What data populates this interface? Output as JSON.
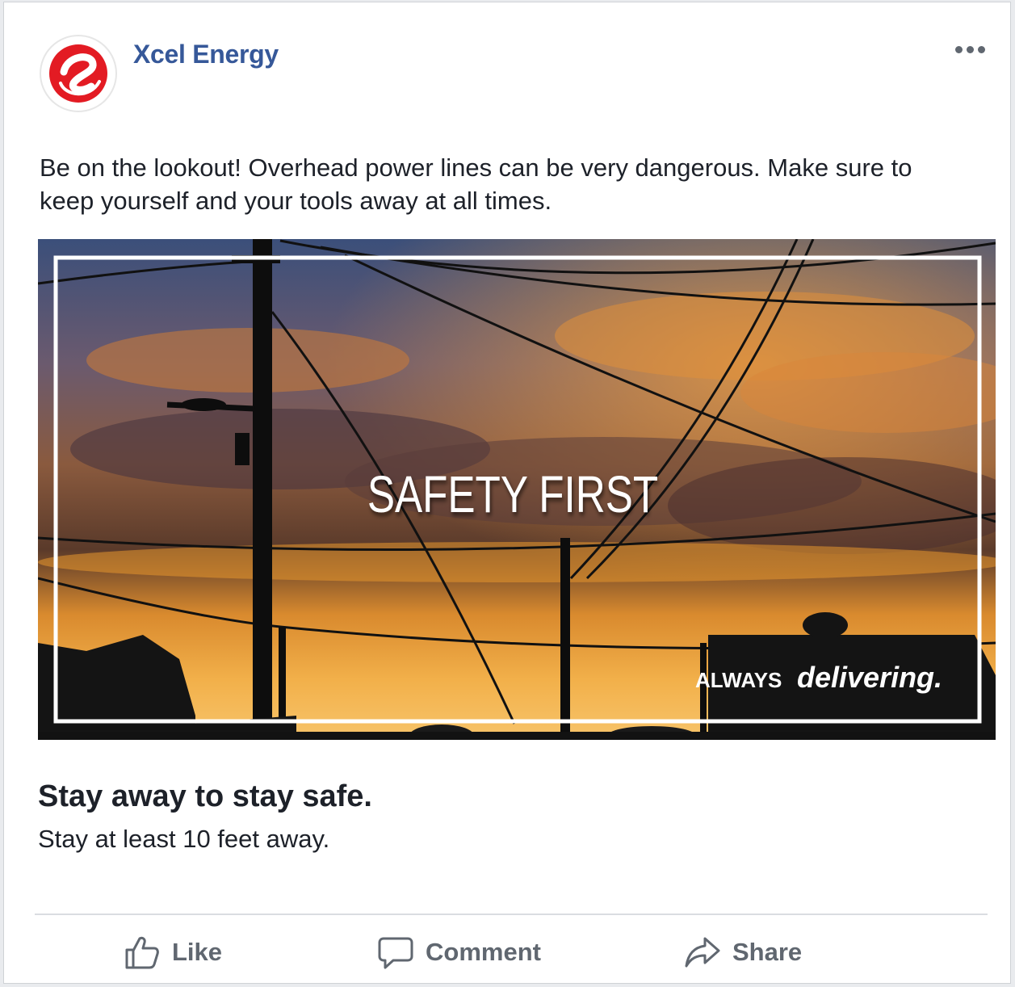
{
  "post": {
    "page_name": "Xcel Energy",
    "text": "Be on the lookout! Overhead power lines can be very dangerous. Make sure to keep yourself and your tools away at all times.",
    "image": {
      "title": "SAFETY FIRST",
      "tagline_small": "ALWAYS",
      "tagline_italic": "delivering."
    },
    "link_headline": "Stay away to stay safe.",
    "link_description": "Stay at least 10 feet away."
  },
  "actions": {
    "like_label": "Like",
    "comment_label": "Comment",
    "share_label": "Share"
  },
  "colors": {
    "brand": "#e31b23",
    "page_name": "#365899",
    "action_text": "#606770"
  },
  "icons": [
    "xcel-logo-icon",
    "more-options-icon",
    "like-icon",
    "comment-icon",
    "share-icon"
  ]
}
